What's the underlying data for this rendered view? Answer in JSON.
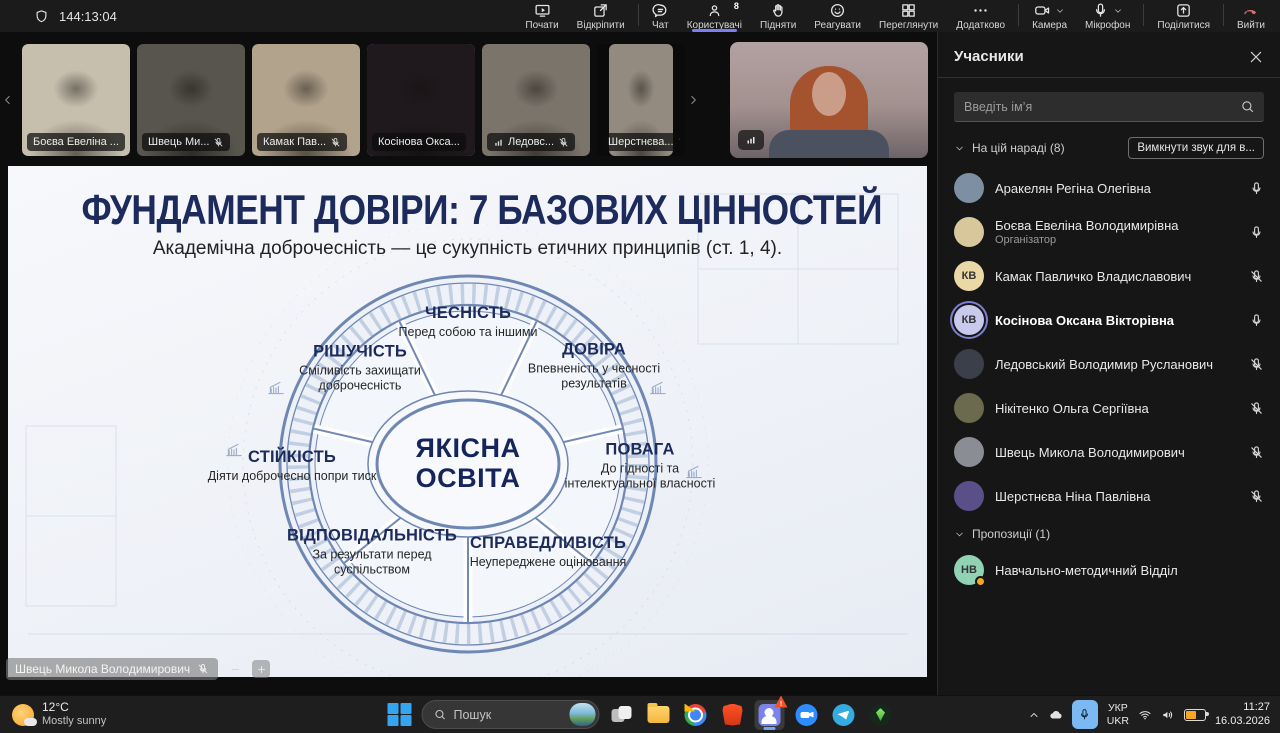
{
  "meeting_toolbar": {
    "timer": "144:13:04",
    "participants_count": "8",
    "buttons": [
      "Почати",
      "Відкріпити",
      "Чат",
      "Користувачі",
      "Підняти",
      "Реагувати",
      "Переглянути",
      "Додатково",
      "Камера",
      "Мікрофон",
      "Поділитися",
      "Вийти"
    ]
  },
  "filmstrip": {
    "tiles": [
      {
        "label": "Боєва Евеліна ...",
        "muted": false,
        "signal": false,
        "speaking": false,
        "narrow": false,
        "bg": "#c7bfae"
      },
      {
        "label": "Швець Ми...",
        "muted": true,
        "signal": false,
        "speaking": false,
        "narrow": false,
        "bg": "#57554d"
      },
      {
        "label": "Камак Пав...",
        "muted": true,
        "signal": false,
        "speaking": false,
        "narrow": false,
        "bg": "#b1a38c"
      },
      {
        "label": "Косінова Окса...",
        "muted": false,
        "signal": false,
        "speaking": true,
        "narrow": false,
        "bg": "#1f191e"
      },
      {
        "label": "Ледовс...",
        "muted": true,
        "signal": true,
        "speaking": false,
        "narrow": false,
        "bg": "#7b746b"
      },
      {
        "label": "Шерстнєва...",
        "muted": true,
        "signal": false,
        "speaking": false,
        "narrow": true,
        "bg": "#938b80"
      }
    ]
  },
  "presenter_overlay": {
    "name": "Швець Микола Володимирович"
  },
  "slide": {
    "title": "ФУНДАМЕНТ ДОВІРИ: 7 БАЗОВИХ ЦІННОСТЕЙ",
    "subtitle": "Академічна доброчесність — це сукупність етичних принципів (ст. 1, 4).",
    "center": {
      "line1": "ЯКІСНА",
      "line2": "ОСВІТА"
    },
    "segments": [
      {
        "title": "ЧЕСНІСТЬ",
        "desc": "Перед собою та іншими"
      },
      {
        "title": "ДОВІРА",
        "desc": "Впевненість у чесності результатів"
      },
      {
        "title": "ПОВАГА",
        "desc": "До гідності та інтелектуальної власності"
      },
      {
        "title": "СПРАВЕДЛИВІСТЬ",
        "desc": "Неупереджене оцінювання"
      },
      {
        "title": "ВІДПОВІДАЛЬНІСТЬ",
        "desc": "За результати перед суспільством"
      },
      {
        "title": "СТІЙКІСТЬ",
        "desc": "Діяти доброчесно попри тиск"
      },
      {
        "title": "РІШУЧІСТЬ",
        "desc": "Сміливість захищати доброчесність"
      }
    ]
  },
  "participants_panel": {
    "title": "Учасники",
    "search_placeholder": "Введіть ім’я",
    "section_meeting": "На цій нараді (8)",
    "mute_all_button": "Вимкнути звук для в...",
    "attendees": [
      {
        "name": "Аракелян Регіна Олегівна",
        "muted": false,
        "avatar_bg": "#7d8fa3"
      },
      {
        "name": "Боєва Евеліна Володимирівна",
        "sub": "Організатор",
        "muted": false,
        "avatar_bg": "#d8c79a"
      },
      {
        "name": "Камак Павличко Владиславович",
        "initials": "КВ",
        "muted": true,
        "avatar_bg": "#ead9a6"
      },
      {
        "name": "Косінова Оксана Вікторівна",
        "initials": "КВ",
        "muted": false,
        "speaking": true,
        "avatar_bg": "#c9c9ee"
      },
      {
        "name": "Ледовський Володимир Русланович",
        "muted": true,
        "avatar_bg": "#3a3f4a"
      },
      {
        "name": "Нікітенко Ольга Сергіївна",
        "muted": true,
        "avatar_bg": "#6b6a4e"
      },
      {
        "name": "Швець Микола Володимирович",
        "muted": true,
        "avatar_bg": "#8a8d93"
      },
      {
        "name": "Шерстнєва Ніна Павлівна",
        "muted": true,
        "avatar_bg": "#5b4f8a"
      }
    ],
    "section_suggestions": "Пропозиції (1)",
    "suggestions": [
      {
        "name": "Навчально-методичний Відділ",
        "initials": "НВ",
        "avatar_bg": "#8fd2b4",
        "badge": true
      }
    ]
  },
  "taskbar": {
    "weather": {
      "temp": "12°C",
      "desc": "Mostly sunny"
    },
    "search_placeholder": "Пошук",
    "language": {
      "line1": "УКР",
      "line2": "UKR"
    },
    "clock": {
      "time": "11:27",
      "date": "16.03.2026"
    }
  },
  "icons": {
    "toolbar": [
      "share-screen-icon",
      "popout-icon",
      "chat-icon",
      "people-icon",
      "raise-hand-icon",
      "react-icon",
      "grid-view-icon",
      "more-icon",
      "camera-icon",
      "mic-icon",
      "share-icon",
      "leave-call-icon"
    ],
    "taskbar_apps": [
      "windows-start",
      "task-view",
      "file-explorer",
      "chrome",
      "brave",
      "teams",
      "zoom",
      "telegram",
      "sims"
    ],
    "tray": [
      "chevron-up-icon",
      "onedrive-icon",
      "mic-tray-icon",
      "wifi-icon",
      "volume-icon",
      "battery-icon"
    ]
  },
  "colors": {
    "accent_purple": "#7b7ff2",
    "leave_red": "#d9706d",
    "slide_heading_navy": "#1c2a5c",
    "wheel_blue": "#6f87b3",
    "speaking_ring": "#7d7fd1",
    "taskbar_mic_blue": "#7cb9f2",
    "teams_purple": "#7b83eb",
    "suggestion_badge_orange": "#f5a623"
  }
}
